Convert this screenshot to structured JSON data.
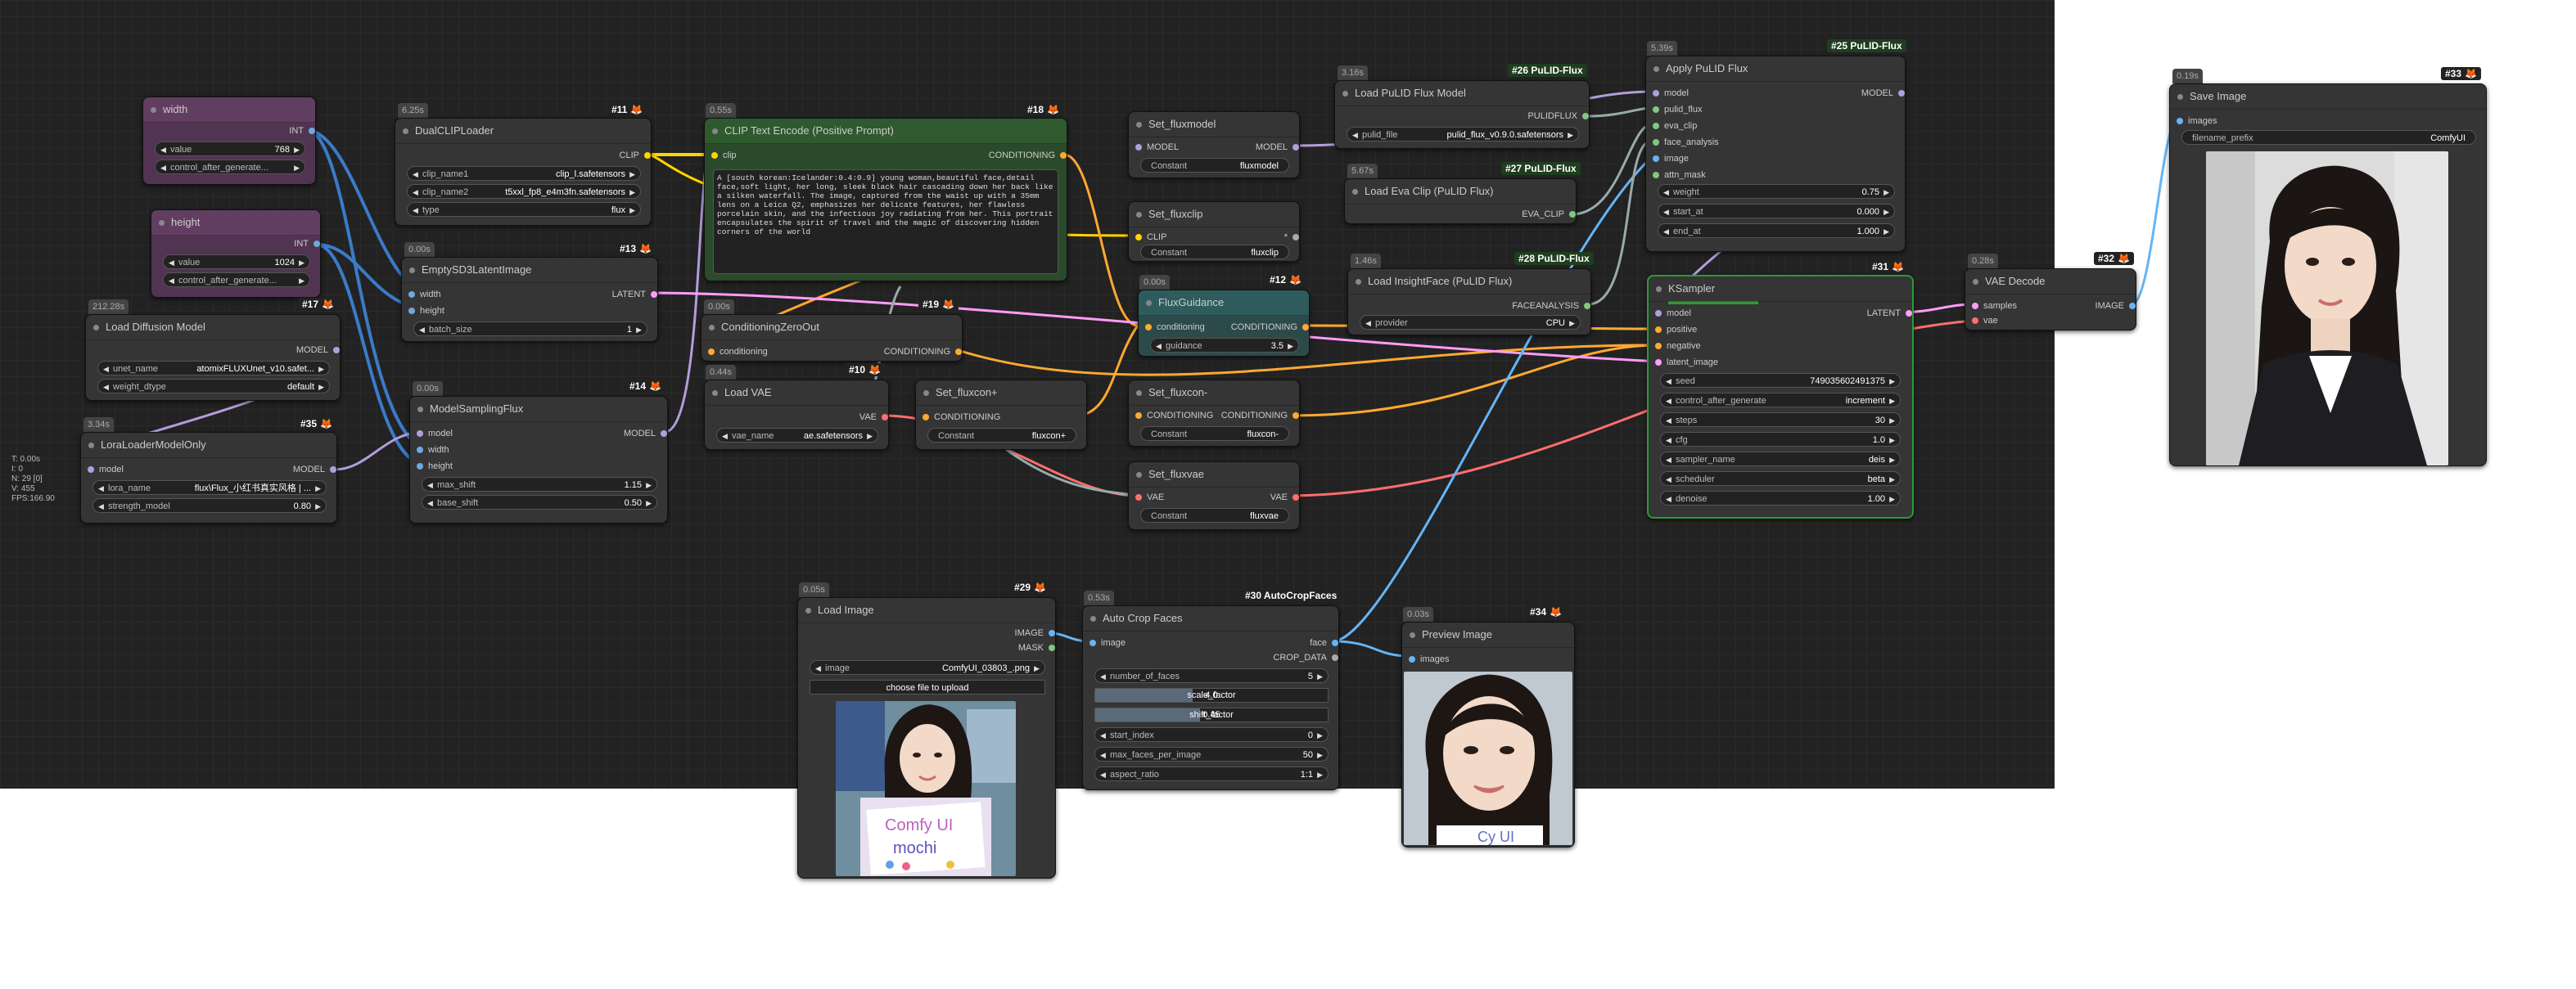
{
  "stats": {
    "lines": [
      "T: 0.00s",
      "I: 0",
      "N: 29 [0]",
      "V: 455",
      "FPS:166.90"
    ]
  },
  "colors": {
    "model": "#b39ddb",
    "clip": "#ffd500",
    "conditioning": "#ffa931",
    "latent": "#ff9cf9",
    "vae": "#ff6e6e",
    "image": "#64b5f6",
    "int": "#6fa8dc",
    "mask": "#81c784",
    "green_accent": "#2e9a36"
  },
  "nodes": {
    "width": {
      "title": "width",
      "out": "INT",
      "value_label": "value",
      "value": "768",
      "control_label": "control_after_generate..."
    },
    "height": {
      "title": "height",
      "out": "INT",
      "value_label": "value",
      "value": "1024",
      "control_label": "control_after_generate..."
    },
    "load_diffusion": {
      "timing": "212.28s",
      "badge": "#17",
      "title": "Load Diffusion Model",
      "out": "MODEL",
      "unet_label": "unet_name",
      "unet_value": "atomixFLUXUnet_v10.safet...",
      "dtype_label": "weight_dtype",
      "dtype_value": "default"
    },
    "lora": {
      "timing": "3.34s",
      "badge": "#35",
      "title": "LoraLoaderModelOnly",
      "in": "model",
      "out": "MODEL",
      "lora_label": "lora_name",
      "lora_value": "flux\\Flux_小红书真实风格 | ...",
      "strength_label": "strength_model",
      "strength_value": "0.80"
    },
    "dualclip": {
      "timing": "6.25s",
      "badge": "#11",
      "title": "DualCLIPLoader",
      "out": "CLIP",
      "c1_label": "clip_name1",
      "c1_value": "clip_l.safetensors",
      "c2_label": "clip_name2",
      "c2_value": "t5xxl_fp8_e4m3fn.safetensors",
      "type_label": "type",
      "type_value": "flux"
    },
    "empty_latent": {
      "timing": "0.00s",
      "badge": "#13",
      "title": "EmptySD3LatentImage",
      "in1": "width",
      "in2": "height",
      "out": "LATENT",
      "batch_label": "batch_size",
      "batch_value": "1"
    },
    "sampling_flux": {
      "timing": "0.00s",
      "badge": "#14",
      "title": "ModelSamplingFlux",
      "in1": "model",
      "in2": "width",
      "in3": "height",
      "out": "MODEL",
      "maxshift_label": "max_shift",
      "maxshift_value": "1.15",
      "baseshift_label": "base_shift",
      "baseshift_value": "0.50"
    },
    "clip_encode": {
      "timing": "0.55s",
      "badge": "#18",
      "title": "CLIP Text Encode (Positive Prompt)",
      "in": "clip",
      "out": "CONDITIONING",
      "prompt": "A [south korean:Icelander:0.4:0.9] young woman,beautiful face,detail face,soft light, her long, sleek black hair cascading down her back like a silken waterfall. The image, captured from the waist up with a 35mm lens on a Leica Q2, emphasizes her delicate features, her flawless porcelain skin, and the infectious joy radiating from her. This portrait encapsulates the spirit of travel and the magic of discovering hidden corners of the world"
    },
    "cond_zero": {
      "timing": "0.00s",
      "badge": "#19",
      "title": "ConditioningZeroOut",
      "in": "conditioning",
      "out": "CONDITIONING"
    },
    "load_vae": {
      "timing": "0.44s",
      "badge": "#10",
      "title": "Load VAE",
      "out": "VAE",
      "vae_label": "vae_name",
      "vae_value": "ae.safetensors"
    },
    "set_fluxcon_plus": {
      "title": "Set_fluxcon+",
      "in": "CONDITIONING",
      "const_label": "Constant",
      "const_value": "fluxcon+"
    },
    "set_fluxmodel": {
      "title": "Set_fluxmodel",
      "in": "MODEL",
      "out": "MODEL",
      "const_label": "Constant",
      "const_value": "fluxmodel"
    },
    "set_fluxclip": {
      "title": "Set_fluxclip",
      "in": "CLIP",
      "out": "*",
      "const_label": "Constant",
      "const_value": "fluxclip"
    },
    "flux_guidance": {
      "timing": "0.00s",
      "badge": "#12",
      "title": "FluxGuidance",
      "in": "conditioning",
      "out": "CONDITIONING",
      "g_label": "guidance",
      "g_value": "3.5"
    },
    "set_fluxcon_minus": {
      "title": "Set_fluxcon-",
      "in": "CONDITIONING",
      "out": "CONDITIONING",
      "const_label": "Constant",
      "const_value": "fluxcon-"
    },
    "set_fluxvae": {
      "title": "Set_fluxvae",
      "in": "VAE",
      "out": "VAE",
      "const_label": "Constant",
      "const_value": "fluxvae"
    },
    "load_pulid": {
      "timing": "3.16s",
      "badge": "#26 PuLID-Flux",
      "title": "Load PuLID Flux Model",
      "out": "PULIDFLUX",
      "file_label": "pulid_file",
      "file_value": "pulid_flux_v0.9.0.safetensors"
    },
    "load_eva": {
      "timing": "5.67s",
      "badge": "#27 PuLID-Flux",
      "title": "Load Eva Clip (PuLID Flux)",
      "out": "EVA_CLIP"
    },
    "load_insight": {
      "timing": "1.46s",
      "badge": "#28 PuLID-Flux",
      "title": "Load InsightFace (PuLID Flux)",
      "out": "FACEANALYSIS",
      "prov_label": "provider",
      "prov_value": "CPU"
    },
    "apply_pulid": {
      "timing": "5.39s",
      "badge": "#25 PuLID-Flux",
      "title": "Apply PuLID Flux",
      "inputs": [
        "model",
        "pulid_flux",
        "eva_clip",
        "face_analysis",
        "image",
        "attn_mask"
      ],
      "out": "MODEL",
      "w_label": "weight",
      "w_value": "0.75",
      "s_label": "start_at",
      "s_value": "0.000",
      "e_label": "end_at",
      "e_value": "1.000"
    },
    "ksampler": {
      "badge": "#31",
      "title": "KSampler",
      "inputs": [
        "model",
        "positive",
        "negative",
        "latent_image"
      ],
      "out": "LATENT",
      "seed_label": "seed",
      "seed_value": "749035602491375",
      "cag_label": "control_after_generate",
      "cag_value": "increment",
      "steps_label": "steps",
      "steps_value": "30",
      "cfg_label": "cfg",
      "cfg_value": "1.0",
      "sampler_label": "sampler_name",
      "sampler_value": "deis",
      "sched_label": "scheduler",
      "sched_value": "beta",
      "denoise_label": "denoise",
      "denoise_value": "1.00"
    },
    "vae_decode": {
      "timing": "0.28s",
      "badge": "#32",
      "title": "VAE Decode",
      "in1": "samples",
      "in2": "vae",
      "out": "IMAGE"
    },
    "save_image": {
      "timing": "0.19s",
      "badge": "#33",
      "title": "Save Image",
      "in": "images",
      "prefix_label": "filename_prefix",
      "prefix_value": "ComfyUI"
    },
    "load_image": {
      "timing": "0.05s",
      "badge": "#29",
      "title": "Load Image",
      "out1": "IMAGE",
      "out2": "MASK",
      "image_label": "image",
      "image_value": "ComfyUI_03803_.png",
      "upload_label": "choose file to upload",
      "photo_sign_line1": "Comfy UI",
      "photo_sign_line2": "mochi"
    },
    "auto_crop": {
      "timing": "0.53s",
      "badge": "#30 AutoCropFaces",
      "title": "Auto Crop Faces",
      "in": "image",
      "out1": "face",
      "out2": "CROP_DATA",
      "nf_label": "number_of_faces",
      "nf_value": "5",
      "scale_label": "scale_factor",
      "scale_value": "4.0",
      "scale_frac": 0.42,
      "shift_label": "shift_factor",
      "shift_value": "0.45",
      "shift_frac": 0.45,
      "si_label": "start_index",
      "si_value": "0",
      "mf_label": "max_faces_per_image",
      "mf_value": "50",
      "ar_label": "aspect_ratio",
      "ar_value": "1:1"
    },
    "preview": {
      "timing": "0.03s",
      "badge": "#34",
      "title": "Preview Image",
      "in": "images",
      "photo_sign_text": "Cy UI"
    }
  }
}
